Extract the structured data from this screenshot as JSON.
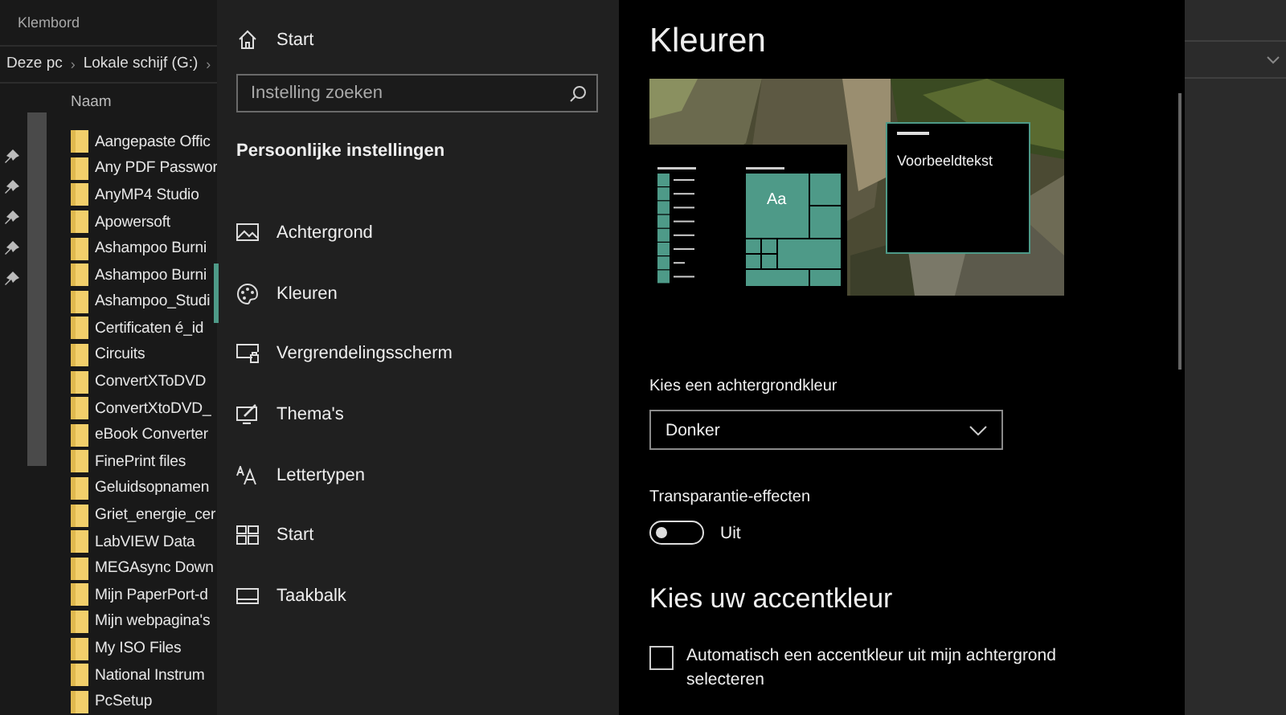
{
  "explorer": {
    "ribbon_label": "Klembord",
    "breadcrumb": [
      {
        "label": "Deze pc",
        "separator": "›"
      },
      {
        "label": "Lokale schijf (G:)",
        "separator": "›"
      }
    ],
    "column": "Naam",
    "files": [
      "Aangepaste Offic",
      "Any PDF Passwor",
      "AnyMP4 Studio",
      "Apowersoft",
      "Ashampoo Burni",
      "Ashampoo Burni",
      "Ashampoo_Studi",
      "Certificaten é_id",
      "Circuits",
      "ConvertXToDVD",
      "ConvertXtoDVD_",
      "eBook Converter",
      "FinePrint files",
      "Geluidsopnamen",
      "Griet_energie_cer",
      "LabVIEW Data",
      "MEGAsync Down",
      "Mijn PaperPort-d",
      "Mijn webpagina's",
      "My ISO Files",
      "National Instrum",
      "PcSetup"
    ]
  },
  "settings": {
    "home": "Start",
    "search": {
      "placeholder": "Instelling zoeken"
    },
    "section": "Persoonlijke instellingen",
    "nav": [
      {
        "label": "Achtergrond",
        "kind": "picture",
        "selected": false
      },
      {
        "label": "Kleuren",
        "kind": "palette",
        "selected": true
      },
      {
        "label": "Vergrendelingsscherm",
        "kind": "lock",
        "selected": false
      },
      {
        "label": "Thema's",
        "kind": "theme",
        "selected": false
      },
      {
        "label": "Lettertypen",
        "kind": "fonts",
        "selected": false
      },
      {
        "label": "Start",
        "kind": "start",
        "selected": false
      },
      {
        "label": "Taakbalk",
        "kind": "taskbar",
        "selected": false
      }
    ]
  },
  "content": {
    "title": "Kleuren",
    "preview": {
      "tile_label": "Aa",
      "sample_text": "Voorbeeldtekst"
    },
    "background_color": {
      "label": "Kies een achtergrondkleur",
      "value": "Donker"
    },
    "transparency": {
      "label": "Transparantie-effecten",
      "on": false,
      "state_label": "Uit"
    },
    "accent": {
      "heading": "Kies uw accentkleur",
      "auto": {
        "label": "Automatisch een accentkleur uit mijn achtergrond selecteren",
        "checked": false
      }
    }
  }
}
